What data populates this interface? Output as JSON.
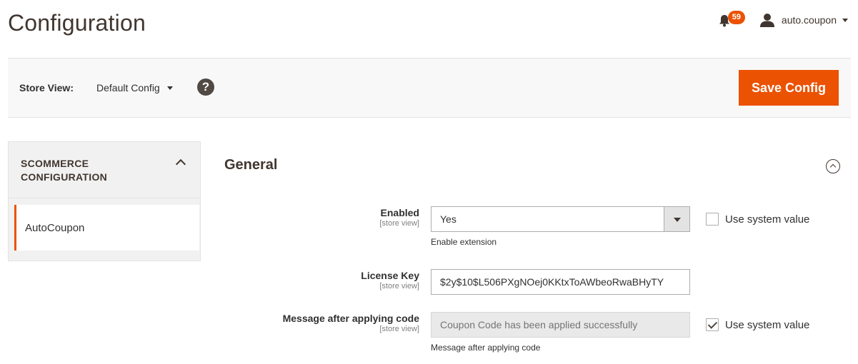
{
  "header": {
    "title": "Configuration",
    "notification_count": "59",
    "user_name": "auto.coupon"
  },
  "toolbar": {
    "store_view_label": "Store View:",
    "store_view_value": "Default Config",
    "help_icon": "?",
    "save_label": "Save Config"
  },
  "sidebar": {
    "group_label": "SCOMMERCE CONFIGURATION",
    "items": [
      {
        "label": "AutoCoupon",
        "active": true
      }
    ]
  },
  "section": {
    "title": "General",
    "fields": [
      {
        "label": "Enabled",
        "scope": "[store view]",
        "value": "Yes",
        "note": "Enable extension",
        "use_system_value_label": "Use system value",
        "use_system_value": false
      },
      {
        "label": "License Key",
        "scope": "[store view]",
        "value": "$2y$10$L506PXgNOej0KKtxToAWbeoRwaBHyTY"
      },
      {
        "label": "Message after applying code",
        "scope": "[store view]",
        "placeholder": "Coupon Code has been applied successfully",
        "note": "Message after applying code",
        "use_system_value_label": "Use system value",
        "use_system_value": true
      }
    ]
  },
  "colors": {
    "accent": "#eb5202",
    "text_dark": "#41362f",
    "toolbar_bg": "#f8f8f8"
  }
}
